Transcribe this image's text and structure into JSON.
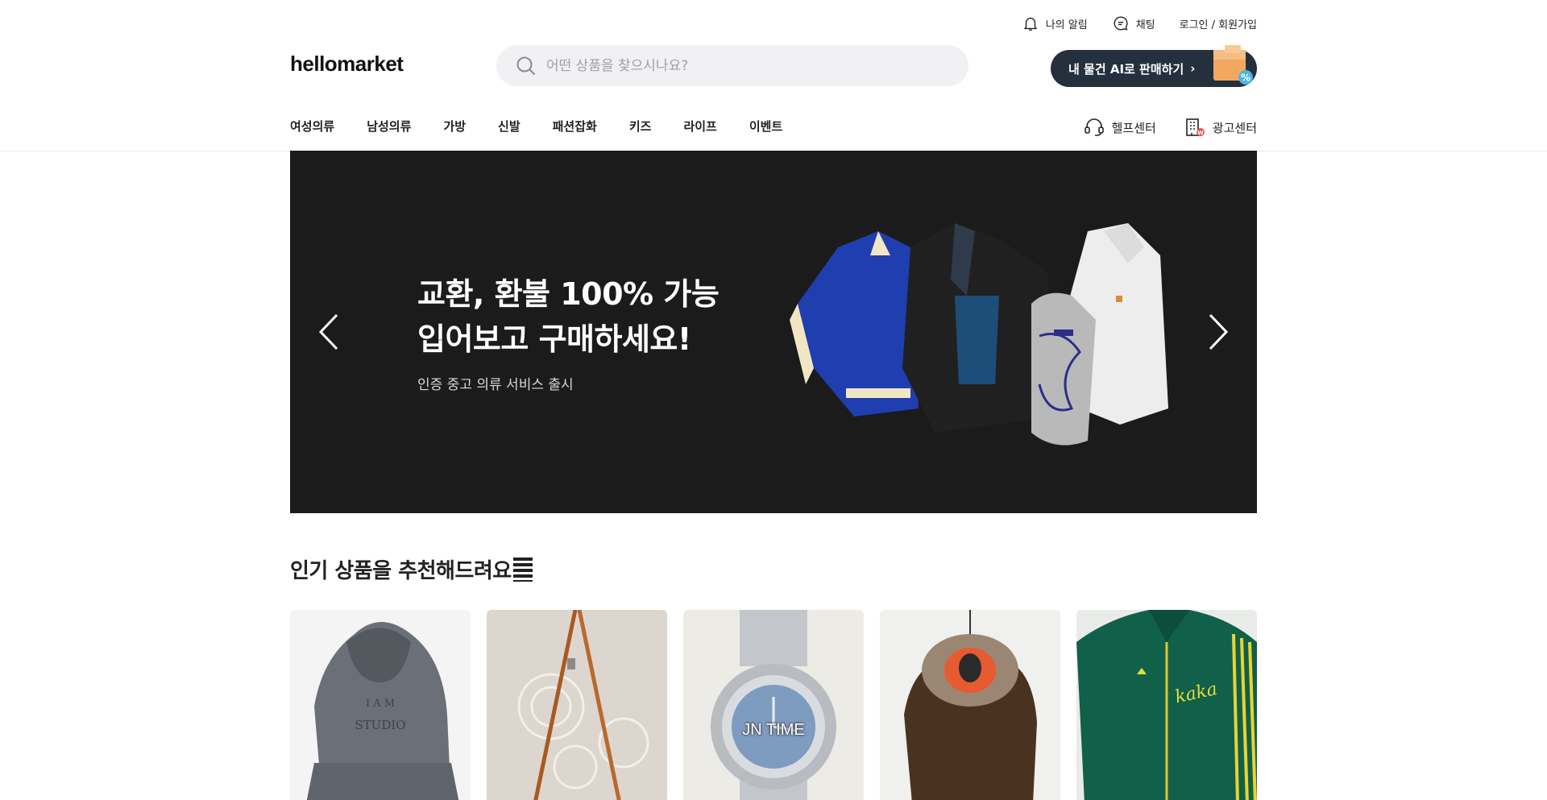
{
  "utility": {
    "notifications": "나의 알림",
    "chat": "채팅",
    "login": "로그인 / 회원가입"
  },
  "header": {
    "logo": "hellomarket",
    "search_placeholder": "어떤 상품을 찾으시나요?",
    "sell_button": "내 물건 AI로 판매하기",
    "sell_arrow": "›"
  },
  "nav": {
    "categories": [
      "여성의류",
      "남성의류",
      "가방",
      "신발",
      "패션잡화",
      "키즈",
      "라이프",
      "이벤트"
    ],
    "help": "헬프센터",
    "ads": "광고센터"
  },
  "banner": {
    "title_line1": "교환, 환불 100% 가능",
    "title_line2": "입어보고 구매하세요!",
    "subtitle": "인증 중고 의류 서비스 출시"
  },
  "section": {
    "title": "인기 상품을 추천해드려요"
  },
  "products": [
    {
      "icon": "gray-hoodie",
      "watermark": ""
    },
    {
      "icon": "leather-strap",
      "watermark": ""
    },
    {
      "icon": "silver-watch",
      "watermark": "JN TIME"
    },
    {
      "icon": "fur-parka",
      "watermark": ""
    },
    {
      "icon": "green-track-jacket",
      "watermark": ""
    }
  ],
  "colors": {
    "banner_bg": "#1b1b1c",
    "sell_button_bg": "#24303e",
    "search_bg": "#f1f1f3"
  }
}
